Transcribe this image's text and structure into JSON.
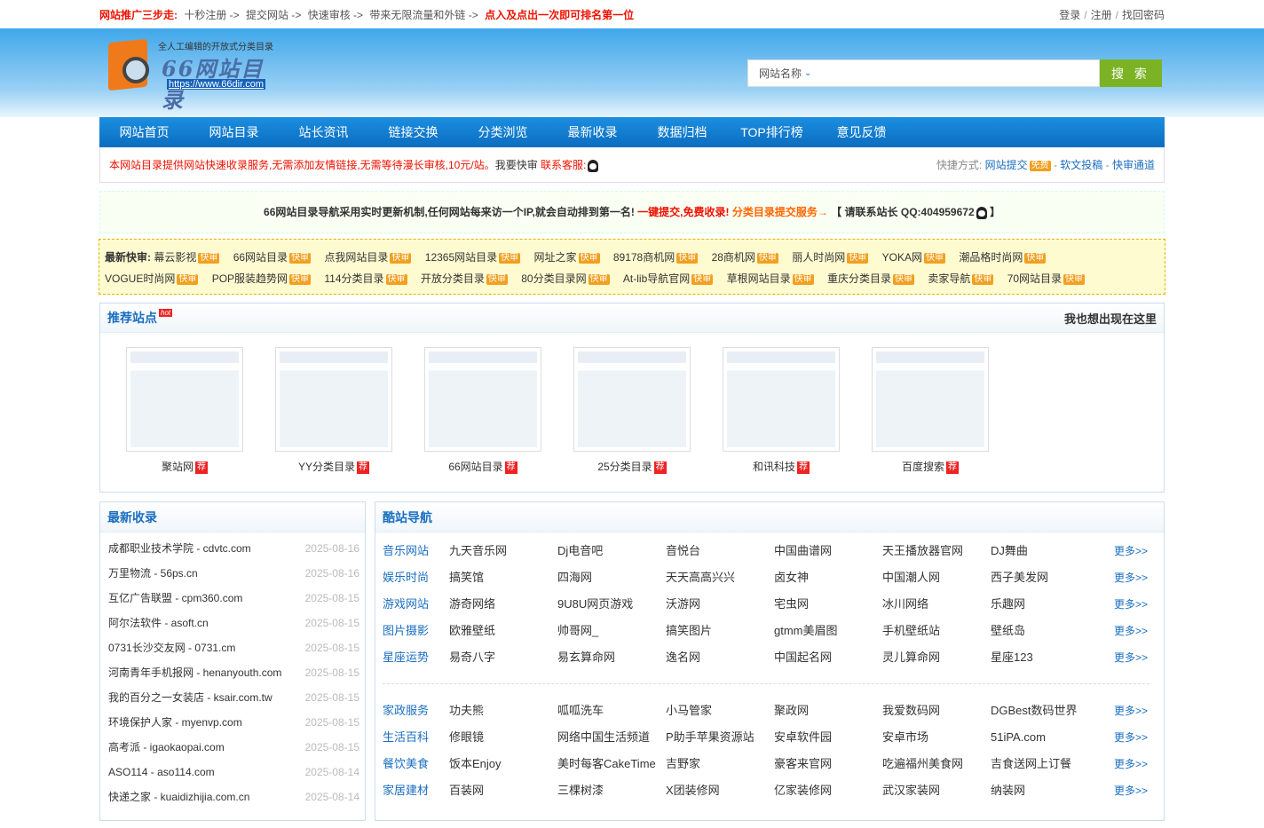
{
  "topbar": {
    "label": "网站推广三步走:",
    "steps": [
      "十秒注册 ->",
      "提交网站 ->",
      "快速审核 ->",
      "带来无限流量和外链 ->"
    ],
    "highlight": "点入及点出一次即可排名第一位",
    "login": "登录",
    "register": "注册",
    "find_password": "找回密码"
  },
  "logo": {
    "slogan": "全人工编辑的开放式分类目录",
    "name": "66网站目录",
    "url": "https://www.66dir.com"
  },
  "search": {
    "select_label": "网站名称",
    "button": "搜 索"
  },
  "nav": [
    "网站首页",
    "网站目录",
    "站长资讯",
    "链接交换",
    "分类浏览",
    "最新收录",
    "数据归档",
    "TOP排行榜",
    "意见反馈"
  ],
  "notice": {
    "text": "本网站目录提供网站快速收录服务,无需添加友情链接,无需等待漫长审核,10元/站。",
    "want": "我要快审",
    "contact": "联系客服:",
    "shortcut_label": "快捷方式:",
    "submit": "网站提交",
    "free_badge": "免费",
    "soft": "软文投稿",
    "fast": "快审通道"
  },
  "promo": {
    "text": "66网站目录导航采用实时更新机制,任何网站每来访一个IP,就会自动排到第一名!",
    "red": "一键提交,免费收录!",
    "orange": "分类目录提交服务→",
    "contact": "【 请联系站长 QQ:404959672",
    "end": "】"
  },
  "fast_review": {
    "title": "最新快审:",
    "badge": "快审",
    "items": [
      "幕云影视",
      "66网站目录",
      "点我网站目录",
      "12365网站目录",
      "网址之家",
      "89178商机网",
      "28商机网",
      "丽人时尚网",
      "YOKA网",
      "潮品格时尚网",
      "VOGUE时尚网",
      "POP服装趋势网",
      "114分类目录",
      "开放分类目录",
      "80分类目录网",
      "At-lib导航官网",
      "草根网站目录",
      "重庆分类目录",
      "卖家导航",
      "70网站目录"
    ]
  },
  "recommended": {
    "title": "推荐站点",
    "hot": "hot",
    "right": "我也想出现在这里",
    "badge": "荐",
    "sites": [
      "聚站网",
      "YY分类目录",
      "66网站目录",
      "25分类目录",
      "和讯科技",
      "百度搜索"
    ]
  },
  "latest": {
    "title": "最新收录",
    "items": [
      {
        "name": "成都职业技术学院 - cdvtc.com",
        "date": "2025-08-16"
      },
      {
        "name": "万里物流 - 56ps.cn",
        "date": "2025-08-16"
      },
      {
        "name": "互亿广告联盟 - cpm360.com",
        "date": "2025-08-15"
      },
      {
        "name": "阿尔法软件 - asoft.cn",
        "date": "2025-08-15"
      },
      {
        "name": "0731长沙交友网 - 0731.cm",
        "date": "2025-08-15"
      },
      {
        "name": "河南青年手机报网 - henanyouth.com",
        "date": "2025-08-15"
      },
      {
        "name": "我的百分之一女装店 - ksair.com.tw",
        "date": "2025-08-15"
      },
      {
        "name": "环境保护人家 - myenvp.com",
        "date": "2025-08-15"
      },
      {
        "name": "高考派 - igaokaopai.com",
        "date": "2025-08-15"
      },
      {
        "name": "ASO114 - aso114.com",
        "date": "2025-08-14"
      },
      {
        "name": "快递之家 - kuaidizhijia.com.cn",
        "date": "2025-08-14"
      }
    ]
  },
  "cool": {
    "title": "酷站导航",
    "more": "更多>>",
    "group1": [
      {
        "cat": "音乐网站",
        "sites": [
          "九天音乐网",
          "Dj电音吧",
          "音悦台",
          "中国曲谱网",
          "天王播放器官网",
          "DJ舞曲"
        ]
      },
      {
        "cat": "娱乐时尚",
        "sites": [
          "搞笑馆",
          "四海网",
          "天天高高兴兴",
          "卤女神",
          "中国潮人网",
          "西子美发网"
        ]
      },
      {
        "cat": "游戏网站",
        "sites": [
          "游奇网络",
          "9U8U网页游戏",
          "沃游网",
          "宅虫网",
          "冰川网络",
          "乐趣网"
        ]
      },
      {
        "cat": "图片摄影",
        "sites": [
          "欧雅壁纸",
          "帅哥网_",
          "搞笑图片",
          "gtmm美眉图",
          "手机壁纸站",
          "壁纸岛"
        ]
      },
      {
        "cat": "星座运势",
        "sites": [
          "易奇八字",
          "易玄算命网",
          "逸名网",
          "中国起名网",
          "灵儿算命网",
          "星座123"
        ]
      }
    ],
    "group2": [
      {
        "cat": "家政服务",
        "sites": [
          "功夫熊",
          "呱呱洗车",
          "小马管家",
          "聚政网",
          "我爱数码网",
          "DGBest数码世界"
        ]
      },
      {
        "cat": "生活百科",
        "sites": [
          "修眼镜",
          "网络中国生活频道",
          "P助手苹果资源站",
          "安卓软件园",
          "安卓市场",
          "51iPA.com"
        ]
      },
      {
        "cat": "餐饮美食",
        "sites": [
          "饭本Enjoy",
          "美时每客CakeTime",
          "吉野家",
          "豪客来官网",
          "吃遍福州美食网",
          "吉食送网上订餐"
        ]
      },
      {
        "cat": "家居建材",
        "sites": [
          "百装网",
          "三棵树漆",
          "X团装修网",
          "亿家装修网",
          "武汉家装网",
          "纳装网"
        ]
      }
    ]
  }
}
